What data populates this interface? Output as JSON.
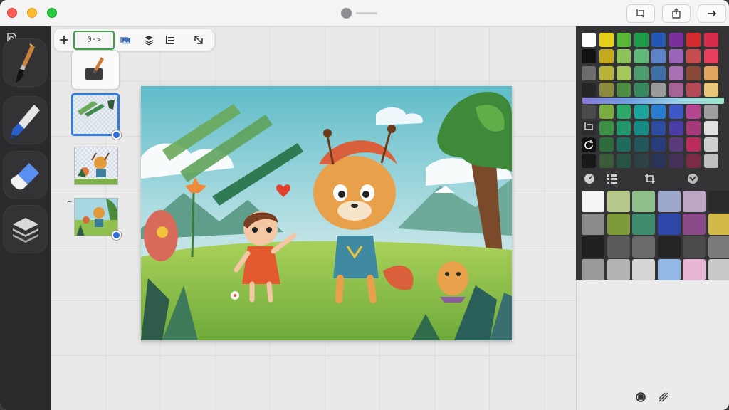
{
  "titlebar": {
    "buttons": [
      {
        "name": "crop-doc-button",
        "icon": "crop-doc-icon"
      },
      {
        "name": "share-button",
        "icon": "share-icon"
      },
      {
        "name": "forward-button",
        "icon": "arrow-right-icon"
      }
    ]
  },
  "float_toolbar": {
    "active_label": "0·>",
    "items": [
      "plus-icon",
      "adjust-icon",
      "image-stack-icon",
      "layers-icon",
      "list-icon",
      "transform-icon"
    ]
  },
  "rail": {
    "tools": [
      "paintbrush-icon",
      "marker-icon",
      "eraser-icon",
      "layers-icon"
    ]
  },
  "colors": {
    "accent": "#2f7de1",
    "active_outline": "#3fa34d",
    "panel_dark": "#343436"
  },
  "palette": {
    "grid": [
      [
        "#ffffff",
        "#e6cf1b",
        "#5cb63a",
        "#1e9b48",
        "#2457b4",
        "#7b2f9b",
        "#d22a2f",
        "#d72b4b"
      ],
      [
        "#111111",
        "#c4a81d",
        "#8ec25a",
        "#5fba7a",
        "#5b83c9",
        "#9b64b8",
        "#c64e4e",
        "#ea3f5d"
      ],
      [
        "#6c6c6c",
        "#b9b23a",
        "#a4c85d",
        "#4c9c6d",
        "#3e6ea7",
        "#a86fb3",
        "#8a4936",
        "#e1a45e"
      ],
      [
        "#252525",
        "#8d8a3e",
        "#4f8d43",
        "#37875f",
        "#9a9a9a",
        "#a56495",
        "#b24955",
        "#e8c77a"
      ],
      [
        "#4a4a4a",
        "#7aab3f",
        "#2ea76b",
        "#1aa39a",
        "#297bd0",
        "#3d58c5",
        "#b4478f",
        "#9e9e9e"
      ],
      [
        "#2c2c2c",
        "#3e8f46",
        "#24956a",
        "#178a86",
        "#2d4d9f",
        "#4a3da3",
        "#a53a7a",
        "#e2e2e2"
      ],
      [
        "#1e1e1e",
        "#2e6b3c",
        "#1f6a5a",
        "#21575c",
        "#293d7c",
        "#5a3a7a",
        "#b92b5a",
        "#cfcfcf"
      ],
      [
        "#181818",
        "#3c5b3a",
        "#285244",
        "#2e4246",
        "#2a3358",
        "#45305a",
        "#7a2c45",
        "#bfbfbf"
      ]
    ],
    "large": [
      [
        "#f5f5f5",
        "#b6c98a",
        "#8fbf8c",
        "#9ea7cc",
        "#bda6c4",
        "#2a2a2a"
      ],
      [
        "#8a8a8a",
        "#7e9a3a",
        "#3e8b6e",
        "#2f47a8",
        "#8a4a8a",
        "#d4b84a"
      ],
      [
        "#202020",
        "#5a5a5a",
        "#6a6a6a",
        "#242424",
        "#4a4a4a",
        "#7a7a7a"
      ],
      [
        "#9a9a9a",
        "#b4b4b4",
        "#d4d4d4",
        "#93b8e6",
        "#e6b6d4",
        "#c8c8c8"
      ]
    ],
    "tab_icons": [
      "dial-icon",
      "swatch-list-icon",
      "crop-icon",
      "globe-icon"
    ],
    "side_icons": [
      "transform-tool-icon",
      "refresh-icon"
    ],
    "bottom_icons": [
      "target-icon",
      "pattern-icon"
    ]
  }
}
